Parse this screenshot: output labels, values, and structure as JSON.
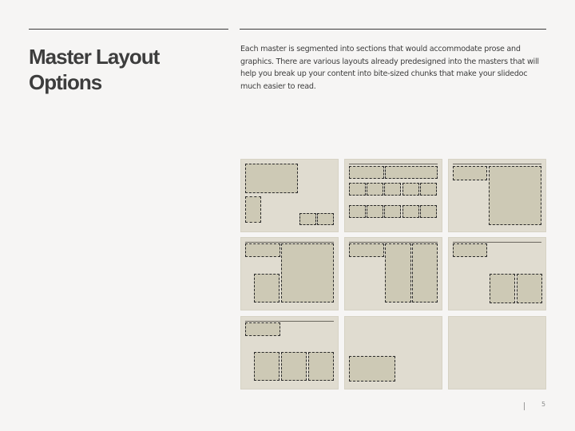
{
  "header": {
    "title": "Master Layout Options",
    "description": "Each master is segmented into sections that would accommodate prose and graphics. There are various layouts already predesigned into the masters that will help you break up your content into bite-sized chunks that make your slidedoc much easier to read."
  },
  "layouts": [
    {
      "name": "layout-1",
      "description": "Wide header block, narrow vertical block, two small bottom-right blocks"
    },
    {
      "name": "layout-2",
      "description": "Two wide header blocks over two rows of five small blocks"
    },
    {
      "name": "layout-3",
      "description": "Small top-left block with large right block"
    },
    {
      "name": "layout-4",
      "description": "Top-left heading block, small lower-left block, large right block"
    },
    {
      "name": "layout-5",
      "description": "Top-left heading block with two tall right columns"
    },
    {
      "name": "layout-6",
      "description": "Top-left heading block with two bottom-right blocks"
    },
    {
      "name": "layout-7",
      "description": "Top-left heading block with three bottom blocks"
    },
    {
      "name": "layout-8",
      "description": "Single bottom-left block"
    },
    {
      "name": "layout-9",
      "description": "Blank layout"
    }
  ],
  "colors": {
    "background": "#f6f5f4",
    "thumbnail": "#e0dcd0",
    "placeholder": "#cdc9b5",
    "text": "#3d3d3d"
  },
  "footer": {
    "page_number": "5"
  }
}
